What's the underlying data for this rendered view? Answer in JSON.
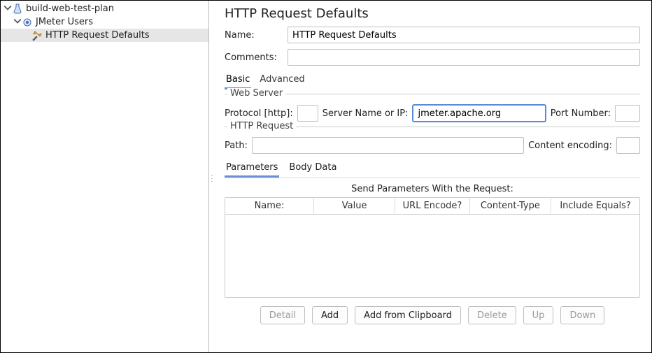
{
  "tree": {
    "items": [
      {
        "label": "build-web-test-plan",
        "icon": "beaker",
        "depth": 0,
        "expanded": true,
        "selected": false
      },
      {
        "label": "JMeter Users",
        "icon": "gear",
        "depth": 1,
        "expanded": true,
        "selected": false
      },
      {
        "label": "HTTP Request Defaults",
        "icon": "wrench",
        "depth": 2,
        "expanded": null,
        "selected": true
      }
    ]
  },
  "panel": {
    "title": "HTTP Request Defaults",
    "name_label": "Name:",
    "name_value": "HTTP Request Defaults",
    "comments_label": "Comments:",
    "comments_value": ""
  },
  "tabs": {
    "basic": "Basic",
    "advanced": "Advanced",
    "active": "basic"
  },
  "web_server": {
    "legend": "Web Server",
    "protocol_label": "Protocol [http]:",
    "protocol_value": "",
    "server_label": "Server Name or IP:",
    "server_value": "jmeter.apache.org",
    "port_label": "Port Number:",
    "port_value": ""
  },
  "http_request": {
    "legend": "HTTP Request",
    "path_label": "Path:",
    "path_value": "",
    "encoding_label": "Content encoding:",
    "encoding_value": ""
  },
  "inner_tabs": {
    "parameters": "Parameters",
    "body_data": "Body Data",
    "active": "parameters"
  },
  "params": {
    "caption": "Send Parameters With the Request:",
    "columns": [
      "Name:",
      "Value",
      "URL Encode?",
      "Content-Type",
      "Include Equals?"
    ]
  },
  "buttons": {
    "detail": "Detail",
    "add": "Add",
    "add_clip": "Add from Clipboard",
    "delete": "Delete",
    "up": "Up",
    "down": "Down"
  }
}
